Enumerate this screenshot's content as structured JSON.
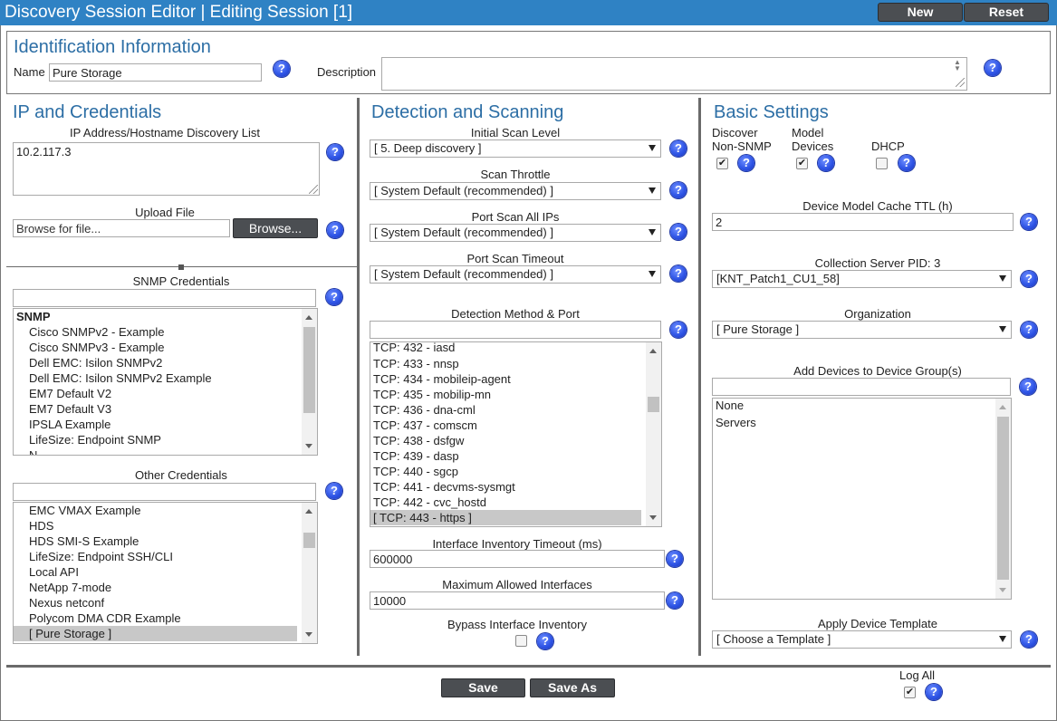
{
  "window": {
    "title": "Discovery Session Editor | Editing Session [1]",
    "new_label": "New",
    "reset_label": "Reset"
  },
  "identification": {
    "heading": "Identification Information",
    "name_label": "Name",
    "name_value": "Pure Storage",
    "description_label": "Description",
    "description_value": ""
  },
  "ip_credentials": {
    "heading": "IP and Credentials",
    "ip_list_label": "IP Address/Hostname Discovery List",
    "ip_list_value": "10.2.117.3",
    "upload_label": "Upload File",
    "upload_placeholder": "Browse for file...",
    "browse_label": "Browse...",
    "snmp_label": "SNMP Credentials",
    "snmp_filter": "",
    "snmp_group": "SNMP",
    "snmp_items": [
      "Cisco SNMPv2 - Example",
      "Cisco SNMPv3 - Example",
      "Dell EMC: Isilon SNMPv2",
      "Dell EMC: Isilon SNMPv2 Example",
      "EM7 Default V2",
      "EM7 Default V3",
      "IPSLA Example",
      "LifeSize: Endpoint SNMP",
      "N..."
    ],
    "other_label": "Other Credentials",
    "other_filter": "",
    "other_items": [
      "EMC VMAX Example",
      "HDS",
      "HDS SMI-S Example",
      "LifeSize: Endpoint SSH/CLI",
      "Local API",
      "NetApp 7-mode",
      "Nexus netconf",
      "Polycom DMA CDR Example",
      "[ Pure Storage ]"
    ]
  },
  "detection": {
    "heading": "Detection and Scanning",
    "initial_scan_label": "Initial Scan Level",
    "initial_scan_value": "[ 5. Deep discovery ]",
    "throttle_label": "Scan Throttle",
    "throttle_value": "[ System Default (recommended) ]",
    "port_all_label": "Port Scan All IPs",
    "port_all_value": "[ System Default (recommended) ]",
    "port_timeout_label": "Port Scan Timeout",
    "port_timeout_value": "[ System Default (recommended) ]",
    "method_label": "Detection Method & Port",
    "method_filter": "",
    "ports": [
      "TCP: 432 - iasd",
      "TCP: 433 - nnsp",
      "TCP: 434 - mobileip-agent",
      "TCP: 435 - mobilip-mn",
      "TCP: 436 - dna-cml",
      "TCP: 437 - comscm",
      "TCP: 438 - dsfgw",
      "TCP: 439 - dasp",
      "TCP: 440 - sgcp",
      "TCP: 441 - decvms-sysmgt",
      "TCP: 442 - cvc_hostd",
      "[ TCP: 443 - https ]"
    ],
    "iface_timeout_label": "Interface Inventory Timeout (ms)",
    "iface_timeout_value": "600000",
    "max_iface_label": "Maximum Allowed Interfaces",
    "max_iface_value": "10000",
    "bypass_label": "Bypass Interface Inventory"
  },
  "basic": {
    "heading": "Basic Settings",
    "discover_label_1": "Discover",
    "discover_label_2": "Non-SNMP",
    "model_label_1": "Model",
    "model_label_2": "Devices",
    "dhcp_label": "DHCP",
    "cache_label": "Device Model Cache TTL (h)",
    "cache_value": "2",
    "collector_label": "Collection Server PID: 3",
    "collector_value": "[KNT_Patch1_CU1_58]",
    "org_label": "Organization",
    "org_value": "[ Pure Storage ]",
    "group_label": "Add Devices to Device Group(s)",
    "group_filter": "",
    "groups": [
      "None",
      "Servers"
    ],
    "template_label": "Apply Device Template",
    "template_value": "[ Choose a Template ]"
  },
  "footer": {
    "save_label": "Save",
    "save_as_label": "Save As",
    "log_all_label": "Log All"
  },
  "checkboxes": {
    "discover_non_snmp": true,
    "model_devices": true,
    "dhcp": false,
    "bypass_interface": false,
    "log_all": true
  }
}
